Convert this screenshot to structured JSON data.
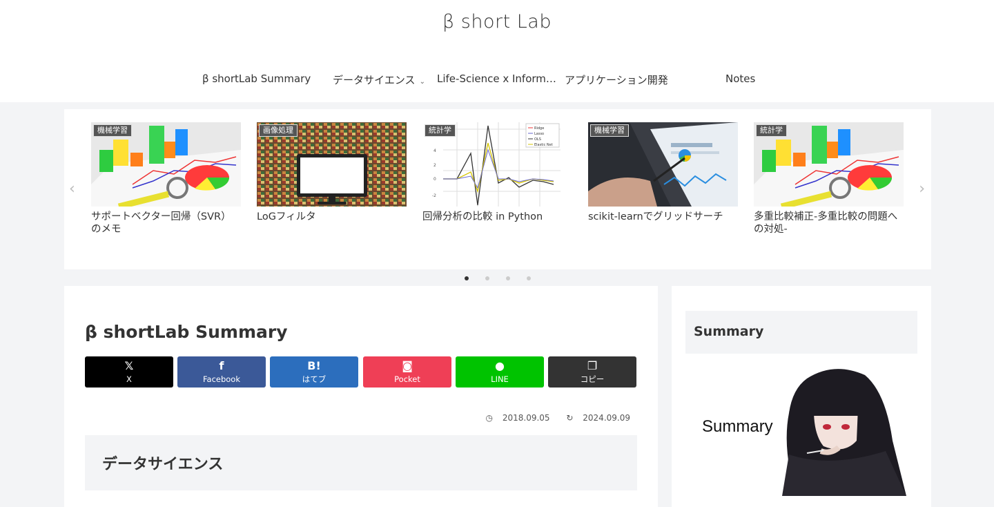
{
  "site": {
    "title": "β short Lab"
  },
  "nav": [
    {
      "label": "β shortLab Summary"
    },
    {
      "label": "データサイエンス",
      "chevron": "chevron-down-icon"
    },
    {
      "label": "Life-Science x Inform…"
    },
    {
      "label": "アプリケーション開発"
    },
    {
      "label": "Notes"
    }
  ],
  "carousel": {
    "prev_icon": "chevron-left-icon",
    "next_icon": "chevron-right-icon",
    "cards": [
      {
        "category": "機械学習",
        "title": "サポートベクター回帰（SVR）のメモ"
      },
      {
        "category": "画像処理",
        "title": "LoGフィルタ"
      },
      {
        "category": "統計学",
        "title": "回帰分析の比較 in Python"
      },
      {
        "category": "機械学習",
        "title": "scikit-learnでグリッドサーチ"
      },
      {
        "category": "統計学",
        "title": "多重比較補正-多重比較の問題への対処-"
      }
    ],
    "chart_legend": [
      "Ridge",
      "Lasso",
      "OLS",
      "Elastic Net"
    ],
    "chart_ticks": [
      "4",
      "2",
      "0",
      "-2"
    ],
    "dots_total": 4,
    "dots_active": 1
  },
  "post": {
    "title": "β shortLab Summary",
    "share": [
      {
        "icon": "x-icon",
        "glyph": "𝕏",
        "label": "X",
        "color": "#000000"
      },
      {
        "icon": "facebook-icon",
        "glyph": "f",
        "label": "Facebook",
        "color": "#3b5998"
      },
      {
        "icon": "hatena-icon",
        "glyph": "B!",
        "label": "はてブ",
        "color": "#2c6ebd"
      },
      {
        "icon": "pocket-icon",
        "glyph": "◙",
        "label": "Pocket",
        "color": "#ef3f56"
      },
      {
        "icon": "line-icon",
        "glyph": "●",
        "label": "LINE",
        "color": "#00c300"
      },
      {
        "icon": "copy-icon",
        "glyph": "❐",
        "label": "コピー",
        "color": "#333333"
      }
    ],
    "published": "2018.09.05",
    "updated": "2024.09.09",
    "section_heading": "データサイエンス"
  },
  "sidebar": {
    "heading": "Summary",
    "banner_text": "Summary"
  }
}
